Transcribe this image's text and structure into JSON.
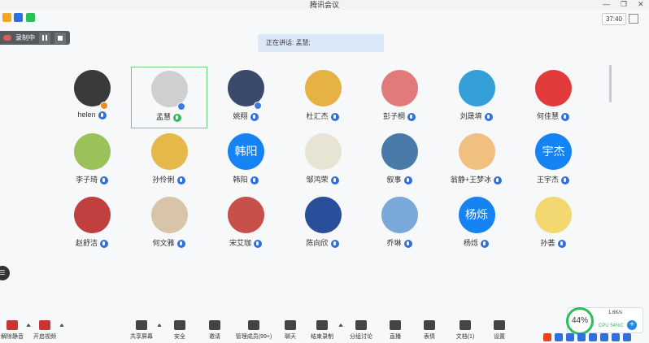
{
  "window": {
    "title": "腾讯会议"
  },
  "header": {
    "timer": "37:40"
  },
  "recording": {
    "label": "录制中"
  },
  "speaking": {
    "text": "正在讲话: 孟慧;"
  },
  "participants": [
    {
      "name": "helen",
      "kind": "photo",
      "color": "#3a3a3a",
      "mic": "blue"
    },
    {
      "name": "孟慧",
      "kind": "photo",
      "color": "#cfcfcf",
      "mic": "green",
      "active": true
    },
    {
      "name": "姚翔",
      "kind": "photo",
      "color": "#3b4a6b",
      "mic": "blue"
    },
    {
      "name": "杜汇杰",
      "kind": "photo",
      "color": "#e5b243",
      "mic": "blue"
    },
    {
      "name": "彭子桐",
      "kind": "photo",
      "color": "#e37a7a",
      "mic": "blue"
    },
    {
      "name": "刘晟堉",
      "kind": "photo",
      "color": "#35a0d8",
      "mic": "blue"
    },
    {
      "name": "何佳慧",
      "kind": "photo",
      "color": "#e23b3b",
      "mic": "blue"
    },
    {
      "name": "李子琦",
      "kind": "photo",
      "color": "#9bc25a",
      "mic": "blue"
    },
    {
      "name": "孙伶俐",
      "kind": "photo",
      "color": "#e6b84a",
      "mic": "blue"
    },
    {
      "name": "韩阳",
      "kind": "text",
      "initials": "韩阳",
      "mic": "blue"
    },
    {
      "name": "邹鸿荣",
      "kind": "photo",
      "color": "#e8e4d4",
      "mic": "blue"
    },
    {
      "name": "叙事",
      "kind": "photo",
      "color": "#4a7aa8",
      "mic": "blue"
    },
    {
      "name": "翁静+王梦冰",
      "kind": "photo",
      "color": "#f0c080",
      "mic": "blue"
    },
    {
      "name": "王宇杰",
      "kind": "text",
      "initials": "宇杰",
      "mic": "blue"
    },
    {
      "name": "赵舒洁",
      "kind": "photo",
      "color": "#c04040",
      "mic": "blue"
    },
    {
      "name": "何文雅",
      "kind": "photo",
      "color": "#d8c4a8",
      "mic": "blue"
    },
    {
      "name": "宋艾珈",
      "kind": "photo",
      "color": "#c8504a",
      "mic": "blue"
    },
    {
      "name": "陈向欣",
      "kind": "photo",
      "color": "#2a4f9a",
      "mic": "blue"
    },
    {
      "name": "乔琳",
      "kind": "photo",
      "color": "#7aa8d8",
      "mic": "blue"
    },
    {
      "name": "杨烁",
      "kind": "text",
      "initials": "杨烁",
      "mic": "blue"
    },
    {
      "name": "孙荟",
      "kind": "photo",
      "color": "#f3d770",
      "mic": "blue"
    }
  ],
  "toolbar": {
    "unmute": "解除静音",
    "video": "开启视频",
    "share": "共享屏幕",
    "security": "安全",
    "invite": "邀请",
    "members": "管理成员(99+)",
    "chat": "聊天",
    "end_record": "结束录制",
    "breakout": "分组讨论",
    "live": "直播",
    "emoji": "表情",
    "docs": "文档(1)",
    "settings": "设置"
  },
  "stats": {
    "cpu_pct": "44%",
    "net": "1.6K/s",
    "cpu": "CPU 54%C"
  }
}
